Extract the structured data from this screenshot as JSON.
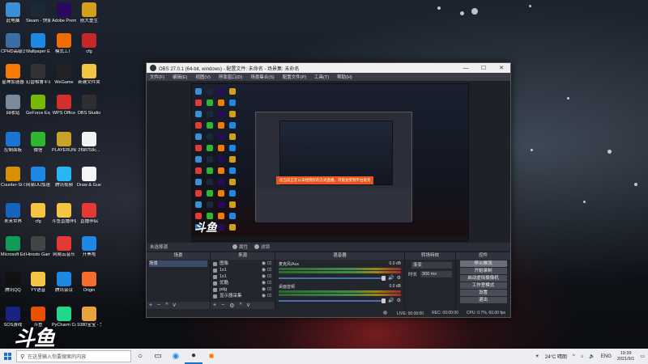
{
  "desktop": {
    "icons": [
      {
        "label": "此电脑",
        "color": "#3b8fd6"
      },
      {
        "label": "Steam - 快捷方式",
        "color": "#1b2838"
      },
      {
        "label": "Adobe Premie...",
        "color": "#2a0a5e"
      },
      {
        "label": "航大重生",
        "color": "#d4a017"
      },
      {
        "label": "CPHD高级识别大王",
        "color": "#3a6ea5"
      },
      {
        "label": "Wallpaper Engine: ...",
        "color": "#1e88e5"
      },
      {
        "label": "模式工厂",
        "color": "#ef6c00"
      },
      {
        "label": "cfg",
        "color": "#c62828"
      },
      {
        "label": "星神加速器",
        "color": "#f57c00"
      },
      {
        "label": "幻兽帕鲁平台",
        "color": "#333"
      },
      {
        "label": "WeGame",
        "color": "#222"
      },
      {
        "label": "新建文件夹",
        "color": "#f4c542"
      },
      {
        "label": "回收站",
        "color": "#7a8a9a"
      },
      {
        "label": "GeForce Experience",
        "color": "#76b900"
      },
      {
        "label": "WPS Office",
        "color": "#d32f2f"
      },
      {
        "label": "OBS Studio",
        "color": "#302e31"
      },
      {
        "label": "控制面板",
        "color": "#1976d2"
      },
      {
        "label": "微信",
        "color": "#2eb82e"
      },
      {
        "label": "PLAYERUNKNOWN'S BATTLEGR...",
        "color": "#c9a227"
      },
      {
        "label": "2f98758c...",
        "color": "#f2f2f2"
      },
      {
        "label": "Counter-St Global Off...",
        "color": "#d98f00"
      },
      {
        "label": "网易UU加速器",
        "color": "#1e88e5"
      },
      {
        "label": "腾讯视频",
        "color": "#29b6f6"
      },
      {
        "label": "Draw & Guess",
        "color": "#f5f5f5"
      },
      {
        "label": "未来世界",
        "color": "#1565c0"
      },
      {
        "label": "cfg",
        "color": "#f4c542"
      },
      {
        "label": "斗鱼直播伴侣",
        "color": "#f4c542"
      },
      {
        "label": "直播伴侣",
        "color": "#e53935"
      },
      {
        "label": "Microsoft Edge",
        "color": "#0f9d58"
      },
      {
        "label": "Hirosto Gami...",
        "color": "#444"
      },
      {
        "label": "网易云音乐",
        "color": "#e53935"
      },
      {
        "label": "开黑啦",
        "color": "#1e88e5"
      },
      {
        "label": "腾讯QQ",
        "color": "#111"
      },
      {
        "label": "YY语音",
        "color": "#f4c542"
      },
      {
        "label": "腾讯会议",
        "color": "#1e88e5"
      },
      {
        "label": "Origin",
        "color": "#f56c2d"
      },
      {
        "label": "SOS游戏",
        "color": "#1a237e"
      },
      {
        "label": "斗鱼",
        "color": "#e65100"
      },
      {
        "label": "PyCharm Communi...",
        "color": "#21d789"
      },
      {
        "label": "1080宝宝 - 文...",
        "color": "#e8a33d"
      }
    ]
  },
  "obs": {
    "title": "OBS 27.0.1 (64-bit, windows) - 配置文件: 未命名 - 场景集: 未命名",
    "menu": [
      "文件(F)",
      "编辑(E)",
      "视图(V)",
      "停靠窗口(D)",
      "场景集合(S)",
      "配置文件(P)",
      "工具(T)",
      "帮助(H)"
    ],
    "window_buttons": [
      "—",
      "☐",
      "✕"
    ],
    "preview_banner": "您当前正在以未经授权的方式直播，可能会受到平台处罚",
    "preview_logo": "斗鱼",
    "toolbar": {
      "no_source": "未选择源",
      "properties": "属性",
      "filters": "滤镜"
    },
    "docks": {
      "scenes": {
        "header": "场景",
        "items": [
          "场景"
        ]
      },
      "sources": {
        "header": "来源",
        "items": [
          "图像",
          "1x1",
          "1x1",
          "优酷",
          "pdg",
          "显示器采集"
        ]
      },
      "mixer": {
        "header": "混音器",
        "channels": [
          {
            "name": "麦克风/Aux",
            "db": "0.0 dB"
          },
          {
            "name": "桌面音频",
            "db": "0.0 dB"
          }
        ]
      },
      "transitions": {
        "header": "转场特效",
        "type_label": "渐变",
        "duration_label": "时长",
        "duration_value": "300 ms"
      },
      "controls": {
        "header": "控件",
        "buttons": [
          "停止推流",
          "开始录制",
          "启动虚拟摄像机",
          "工作室模式",
          "设置",
          "退出"
        ]
      }
    },
    "status": {
      "live": "LIVE: 00:00:00",
      "rec": "REC: 00:00:00",
      "cpu": "CPU: 0.7%, 60.00 fps"
    },
    "footer_buttons": [
      "+",
      "−",
      "^",
      "v"
    ]
  },
  "watermark": "斗鱼",
  "taskbar": {
    "search_placeholder": "在这里输入你要搜索的内容",
    "weather": "24°C 晴朗",
    "lang": "ENG",
    "time": "19:39",
    "date": "2021/9/1",
    "accent": "#1a73c8"
  }
}
